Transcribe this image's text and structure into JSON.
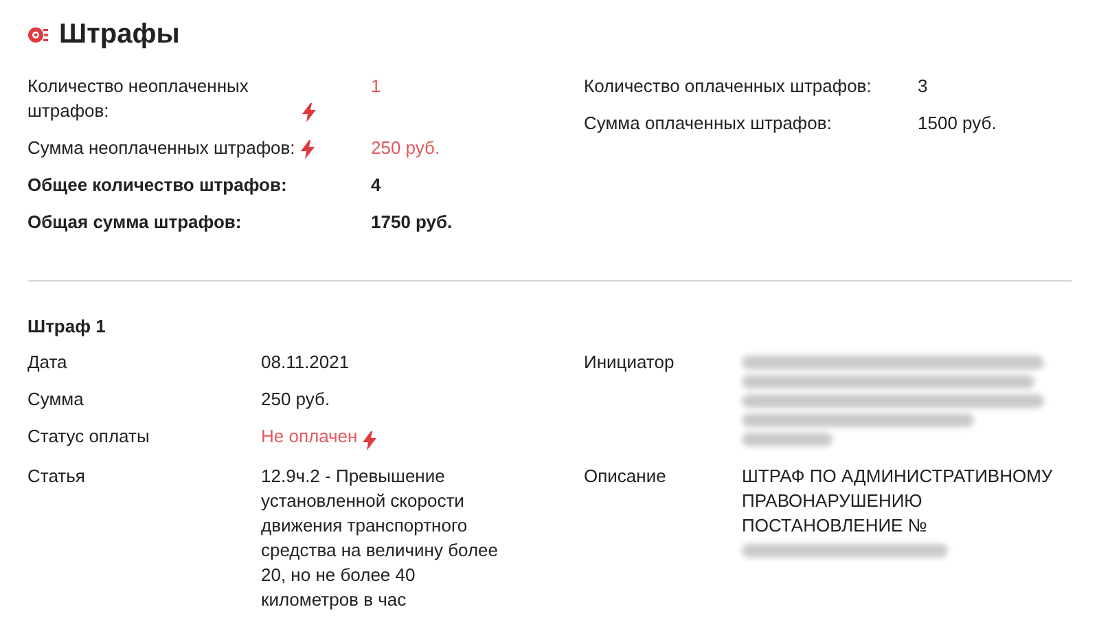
{
  "title": "Штрафы",
  "summary": {
    "left": [
      {
        "label": "Количество неоплаченных штрафов:",
        "value": "1",
        "kind": "unpaid"
      },
      {
        "label": "Сумма неоплаченных штрафов:",
        "value": "250 руб.",
        "kind": "unpaid"
      },
      {
        "label": "Общее количество штрафов:",
        "value": "4",
        "kind": "total"
      },
      {
        "label": "Общая сумма штрафов:",
        "value": "1750 руб.",
        "kind": "total"
      }
    ],
    "right": [
      {
        "label": "Количество оплаченных штрафов:",
        "value": "3"
      },
      {
        "label": "Сумма оплаченных штрафов:",
        "value": "1500 руб."
      }
    ]
  },
  "fine": {
    "title": "Штраф 1",
    "left": [
      {
        "label": "Дата",
        "value": "08.11.2021"
      },
      {
        "label": "Сумма",
        "value": "250 руб."
      },
      {
        "label": "Статус оплаты",
        "value": "Не оплачен",
        "kind": "unpaid"
      },
      {
        "label": "Статья",
        "value": "12.9ч.2 - Превышение установленной скорости движения транспортного средства на величину более 20, но не более 40 километров в час"
      }
    ],
    "right": [
      {
        "label": "Инициатор",
        "kind": "redacted"
      },
      {
        "label": "Описание",
        "value": "ШТРАФ ПО АДМИНИСТРАТИВНОМУ ПРАВОНАРУШЕНИЮ ПОСТАНОВЛЕНИЕ №",
        "kind": "redacted_tail"
      }
    ]
  }
}
